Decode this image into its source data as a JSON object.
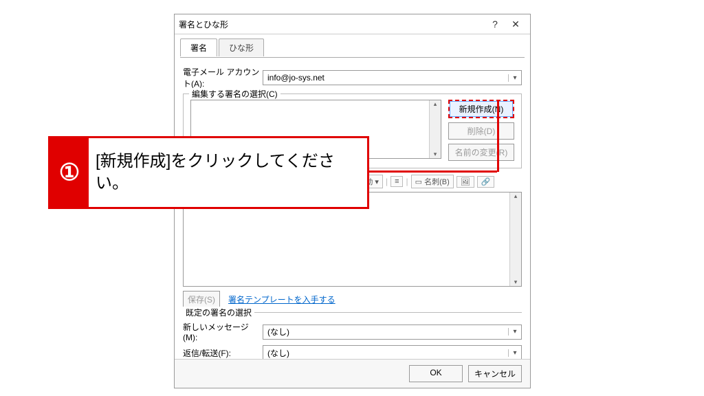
{
  "dialog": {
    "title": "署名とひな形",
    "help": "?",
    "close": "✕"
  },
  "tabs": {
    "signature": "署名",
    "stationery": "ひな形"
  },
  "account": {
    "label": "電子メール アカウント(A):",
    "value": "info@jo-sys.net"
  },
  "select_sig": {
    "legend": "編集する署名の選択(C)",
    "new": "新規作成(N)",
    "delete": "削除(D)",
    "rename": "名前の変更(R)"
  },
  "toolbar": {
    "card": "名刺(B)",
    "pic": "🖼",
    "link": "🔗"
  },
  "below": {
    "save": "保存(S)",
    "templates": "署名テンプレートを入手する"
  },
  "defaults": {
    "legend": "既定の署名の選択",
    "new_msg_label": "新しいメッセージ(M):",
    "reply_label": "返信/転送(F):",
    "none": "(なし)"
  },
  "footer": {
    "ok": "OK",
    "cancel": "キャンセル"
  },
  "callout": {
    "num": "①",
    "text": "[新規作成]をクリックしてください。"
  }
}
